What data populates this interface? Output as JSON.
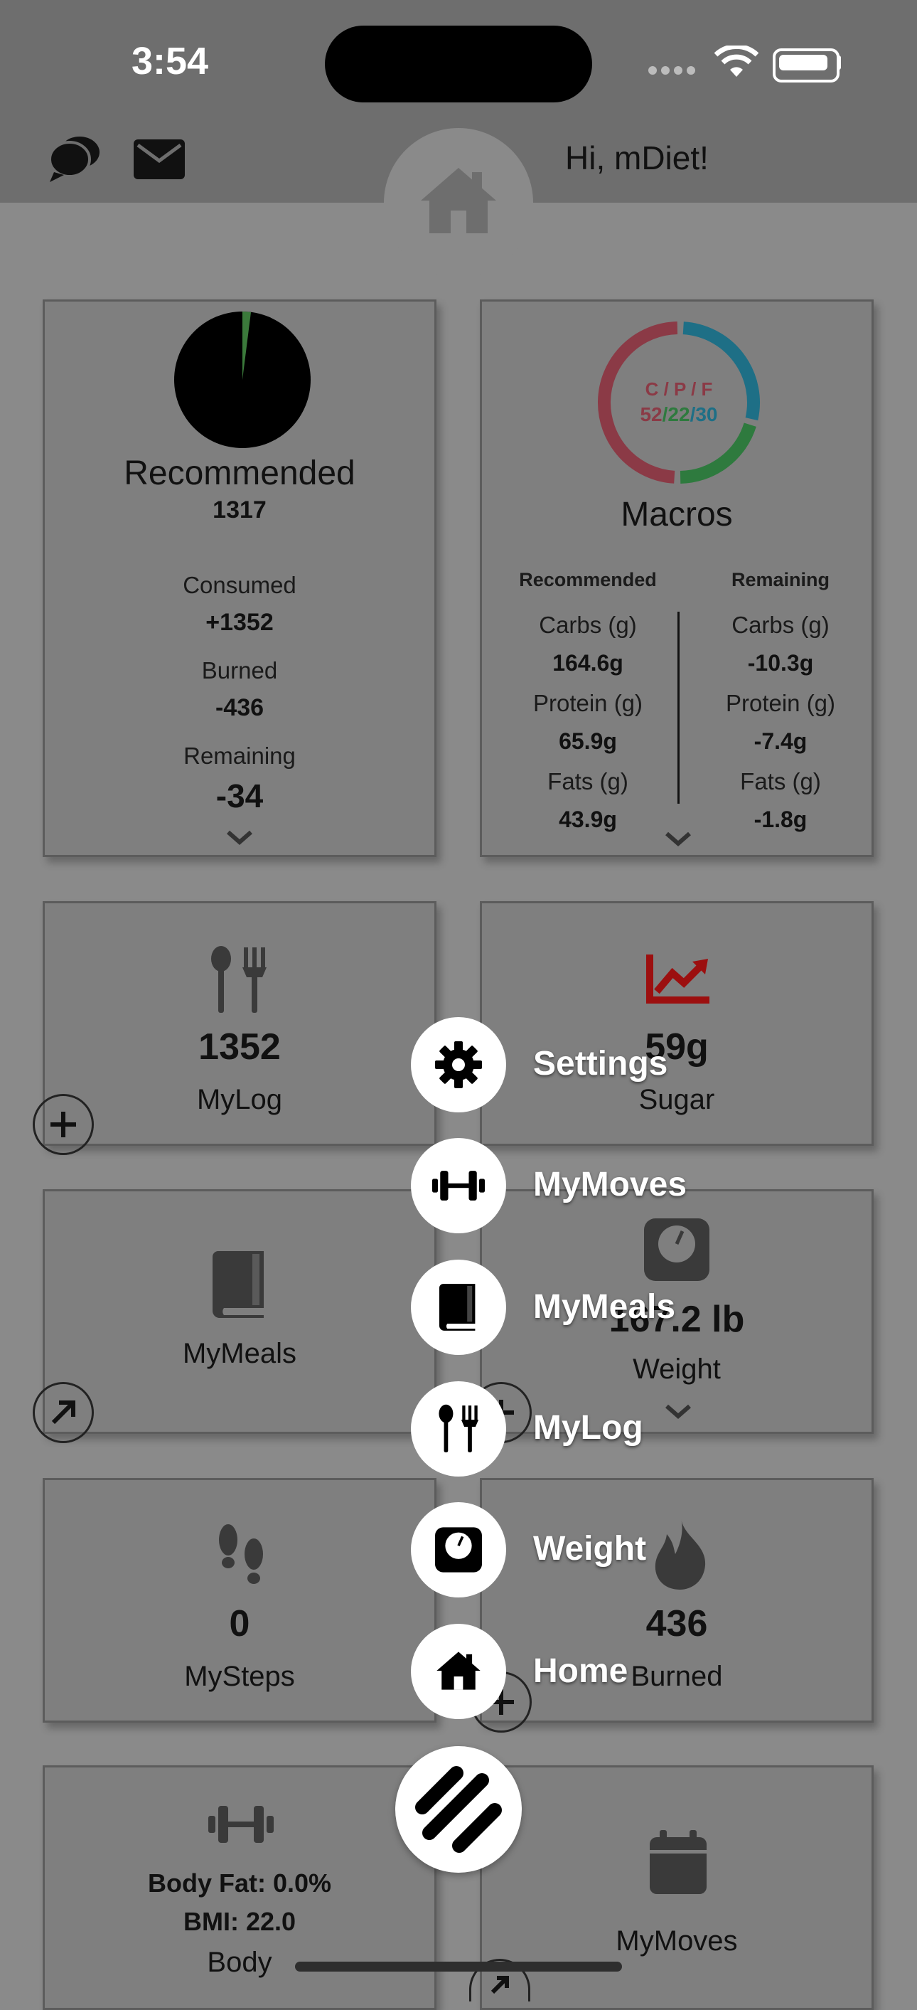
{
  "status_bar": {
    "time": "3:54"
  },
  "header": {
    "greeting": "Hi, mDiet!"
  },
  "calorie_card": {
    "title": "Recommended",
    "recommended_value": "1317",
    "consumed_label": "Consumed",
    "consumed_value": "+1352",
    "burned_label": "Burned",
    "burned_value": "-436",
    "remaining_label": "Remaining",
    "remaining_value": "-34"
  },
  "macros_card": {
    "title": "Macros",
    "ring_label": "C / P / F",
    "ring_values": [
      "52",
      "22",
      "30"
    ],
    "ring_separator": "/",
    "ring_fractions": {
      "carbs": 0.52,
      "protein": 0.22,
      "fats": 0.3
    },
    "recommended_header": "Recommended",
    "remaining_header": "Remaining",
    "recommended": [
      {
        "label": "Carbs (g)",
        "value": "164.6g"
      },
      {
        "label": "Protein (g)",
        "value": "65.9g"
      },
      {
        "label": "Fats (g)",
        "value": "43.9g"
      }
    ],
    "remaining": [
      {
        "label": "Carbs (g)",
        "value": "-10.3g"
      },
      {
        "label": "Protein (g)",
        "value": "-7.4g"
      },
      {
        "label": "Fats (g)",
        "value": "-1.8g"
      }
    ]
  },
  "tiles": {
    "mylog": {
      "value": "1352",
      "label": "MyLog"
    },
    "sugar": {
      "value": "59g",
      "label": "Sugar"
    },
    "mymeals": {
      "label": "MyMeals"
    },
    "weight": {
      "value": "167.2 lb",
      "label": "Weight"
    },
    "mysteps": {
      "value": "0",
      "label": "MySteps"
    },
    "burned": {
      "value": "436",
      "label": "Burned"
    },
    "body": {
      "body_fat": "Body Fat: 0.0%",
      "bmi": "BMI: 22.0",
      "label": "Body"
    },
    "mymoves": {
      "label": "MyMoves"
    }
  },
  "menu": {
    "items": [
      {
        "label": "Settings",
        "icon": "gear-icon"
      },
      {
        "label": "MyMoves",
        "icon": "dumbbell-icon"
      },
      {
        "label": "MyMeals",
        "icon": "book-icon"
      },
      {
        "label": "MyLog",
        "icon": "utensils-icon"
      },
      {
        "label": "Weight",
        "icon": "scale-icon"
      },
      {
        "label": "Home",
        "icon": "home-icon"
      }
    ]
  },
  "colors": {
    "carbs": "#8b3a46",
    "protein": "#2e7a3e",
    "fats": "#1e6f86",
    "sugar_icon": "#9c0f0f"
  }
}
